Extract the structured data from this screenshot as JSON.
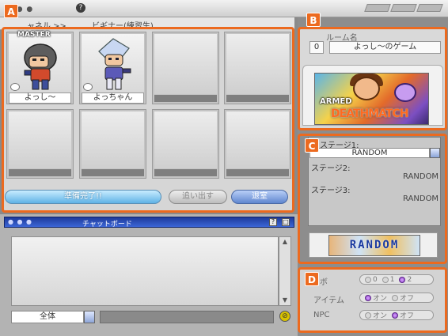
{
  "topbar": {
    "help_icon_text": "?"
  },
  "breadcrumb": {
    "channel": "ャネル >>",
    "room_type": "ビギナー(練習生)"
  },
  "panels": {
    "a": "A",
    "b": "B",
    "c": "C",
    "d": "D"
  },
  "players": {
    "master_label": "MASTER",
    "slots": [
      {
        "name": "よっし～"
      },
      {
        "name": "よっちゃん"
      }
    ]
  },
  "actions": {
    "ready": "準備完了!!",
    "kick": "追い出す",
    "leave": "退室"
  },
  "chat": {
    "title": "チャットボード",
    "help_btn": "?",
    "min_btn": "□",
    "scope": "全体"
  },
  "room": {
    "label": "ルーム名",
    "number": "0",
    "name": "よっし～のゲーム",
    "mode_title_top": "ARMED",
    "mode_title_bottom": "DEATHMATCH"
  },
  "stages": {
    "s1_label": "ステージ1:",
    "s1_value": "RANDOM",
    "s2_label": "ステージ2:",
    "s2_value": "RANDOM",
    "s3_label": "ステージ3:",
    "s3_value": "RANDOM",
    "preview_text": "RANDOM"
  },
  "options": {
    "bot_label": "ボ",
    "bot_0": "0",
    "bot_1": "1",
    "bot_2": "2",
    "item_label": "アイテム",
    "item_on": "オン",
    "item_off": "オフ",
    "npc_label": "NPC",
    "npc_on": "オン",
    "npc_off": "オフ"
  },
  "colors": {
    "accent_orange": "#ec6a1f",
    "chat_header_blue": "#2a4fb8",
    "ready_blue": "#5fb2e6"
  }
}
